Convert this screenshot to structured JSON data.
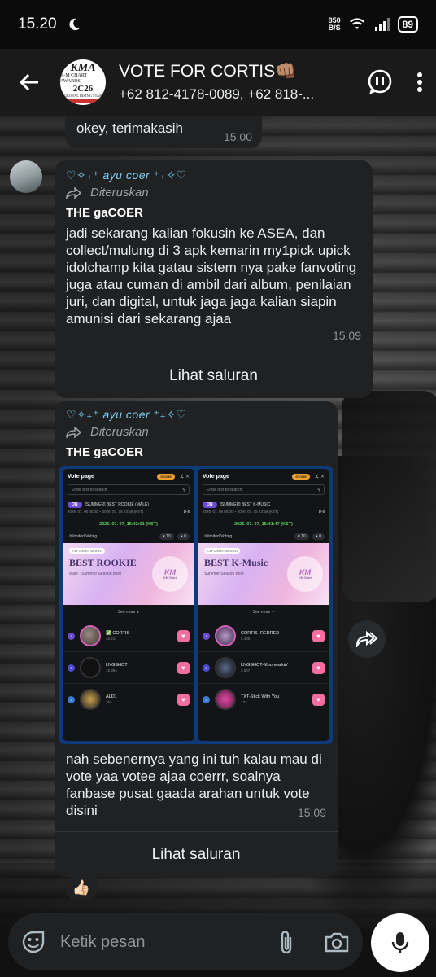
{
  "status": {
    "time": "15.20",
    "net_value": "850",
    "net_unit": "B/S",
    "battery": "89"
  },
  "header": {
    "title": "VOTE FOR CORTIS👊🏽",
    "subtitle": "+62 812-4178-0089, +62 818-...",
    "avatar": {
      "line1": "KMA",
      "line2": "K-M CHART AWARDS",
      "line3": "2C26",
      "line4": "GLOBAL RISING STAR"
    }
  },
  "messages": {
    "previous": {
      "text": "okey, terimakasih",
      "time": "15.00"
    },
    "forward1": {
      "sender": "♡✧₊⁺ ayu coer ⁺₊✧♡",
      "forwarded_label": "Diteruskan",
      "origin": "THE gaCOER",
      "text": "jadi sekarang kalian fokusin ke ASEA, dan collect/mulung di 3 apk kemarin my1pick upick idolchamp kita gatau sistem nya pake fanvoting juga atau cuman di ambil dari album, penilaian juri, dan digital, untuk jaga jaga kalian siapin amunisi dari sekarang ajaa",
      "time": "15.09",
      "channel_button": "Lihat saluran"
    },
    "forward2": {
      "sender": "♡✧₊⁺ ayu coer ⁺₊✧♡",
      "forwarded_label": "Diteruskan",
      "origin": "THE gaCOER",
      "text": "nah sebenernya yang ini tuh kalau mau di vote yaa votee ajaa coerrr, soalnya fanbase pusat gaada arahan untuk vote disini",
      "time": "15.09",
      "channel_button": "Lihat saluran",
      "reaction": "👍🏻"
    }
  },
  "embed": {
    "panels": [
      {
        "title": "Vote page",
        "store": "STORE",
        "search_placeholder": "Enter text to search.",
        "on": "ON",
        "category": "[SUMMER] BEST ROOKIE (MALE)",
        "range": "2026. 07. 06 00:00 ~ 2026. 07. 15 23:59 (KST)",
        "dday": "D-8",
        "now": "2026. 07. 07_15:42:01 (KST)",
        "unlimited": "Unlimited Voting",
        "heart1": "♥ 10",
        "heart2": "● 0",
        "banner_tag": "K-M CHART WORLD",
        "banner_title": "BEST ROOKIE",
        "banner_season": "Male · Summer Season Best",
        "logo": "KM",
        "logo_sub": "KM Chart",
        "see_more": "See more ∨",
        "items": [
          {
            "rank": "1",
            "name": "✅ CORTIS",
            "count": "42,211"
          },
          {
            "rank": "2",
            "name": "LNGSHOT",
            "count": "15,394"
          },
          {
            "rank": "3",
            "name": "ALD1",
            "count": "353"
          }
        ]
      },
      {
        "title": "Vote page",
        "store": "STORE",
        "search_placeholder": "Enter text to search.",
        "on": "ON",
        "category": "[SUMMER] BEST K-MUSIC",
        "range": "2026. 07. 06 00:00 ~ 2026. 07. 15 23:59 (KST)",
        "dday": "D-8",
        "now": "2026. 07. 07_15:41:47 (KST)",
        "unlimited": "Unlimited Voting",
        "heart1": "♥ 10",
        "heart2": "● 0",
        "banner_tag": "K-M CHART WORLD",
        "banner_title": "BEST K-Music",
        "banner_season": "Summer Season Best",
        "logo": "KM",
        "logo_sub": "KM Chart",
        "see_more": "See more ∨",
        "items": [
          {
            "rank": "1",
            "name": "CORTIS- REDRED",
            "count": "5,486"
          },
          {
            "rank": "2",
            "name": "LNGSHOT-Moonwalkin'",
            "count": "3,047"
          },
          {
            "rank": "3",
            "name": "TXT-Stick With You",
            "count": "173"
          }
        ]
      }
    ]
  },
  "input": {
    "placeholder": "Ketik pesan"
  },
  "icons": {
    "back": "back-arrow-icon",
    "call": "call-icon",
    "menu": "more-vert-icon",
    "emoji": "emoji-icon",
    "attach": "attach-icon",
    "camera": "camera-icon",
    "mic": "mic-icon",
    "share": "forward-icon"
  },
  "colors": {
    "header_bg": "#1a1a1a",
    "bubble_bg": "#1f2123",
    "sender_color": "#7ecff0",
    "embed_border": "#0e3a78",
    "heart_pink": "#f06fa0"
  }
}
